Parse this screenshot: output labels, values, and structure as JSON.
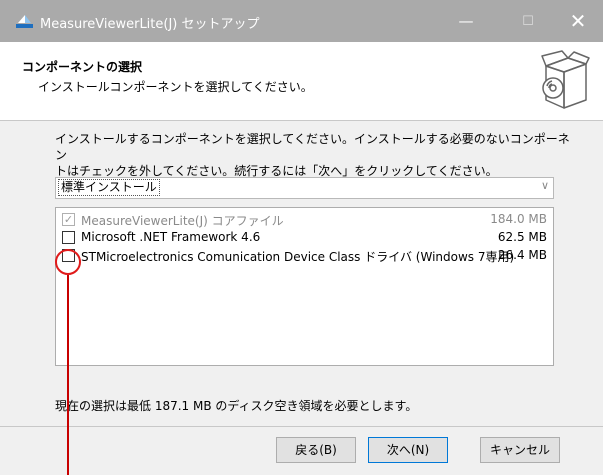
{
  "window": {
    "title": "MeasureViewerLite(J) セットアップ",
    "minimize_glyph": "—",
    "maximize_glyph": "☐",
    "close_glyph": "✕",
    "icon": "installer-icon"
  },
  "header": {
    "title": "コンポーネントの選択",
    "subtitle": "インストールコンポーネントを選択してください。",
    "image": "software-box-cd-icon"
  },
  "description": {
    "line1": "インストールするコンポーネントを選択してください。インストールする必要のないコンポーネン",
    "line2": "トはチェックを外してください。続行するには「次へ」をクリックしてください。"
  },
  "install_type": {
    "selected": "標準インストール",
    "chevron": "∨"
  },
  "components": [
    {
      "name": "MeasureViewerLite(J) コアファイル",
      "size": "184.0 MB",
      "checked": true,
      "disabled": true,
      "check_glyph": "✓"
    },
    {
      "name": "Microsoft .NET Framework 4.6",
      "size": "62.5 MB",
      "checked": false,
      "disabled": false,
      "check_glyph": ""
    },
    {
      "name": "STMicroelectronics Comunication Device Class ドライバ (Windows 7専用)",
      "size": "26.4 MB",
      "checked": false,
      "disabled": false,
      "check_glyph": ""
    }
  ],
  "space_required": "現在の選択は最低 187.1 MB のディスク空き領域を必要とします。",
  "buttons": {
    "back": "戻る(B)",
    "next": "次へ(N)",
    "cancel": "キャンセル"
  },
  "colors": {
    "titlebar": "#aaaaaa",
    "body": "#f0f0f0",
    "annotation": "#e01a1a",
    "focus_border": "#0078d7"
  }
}
